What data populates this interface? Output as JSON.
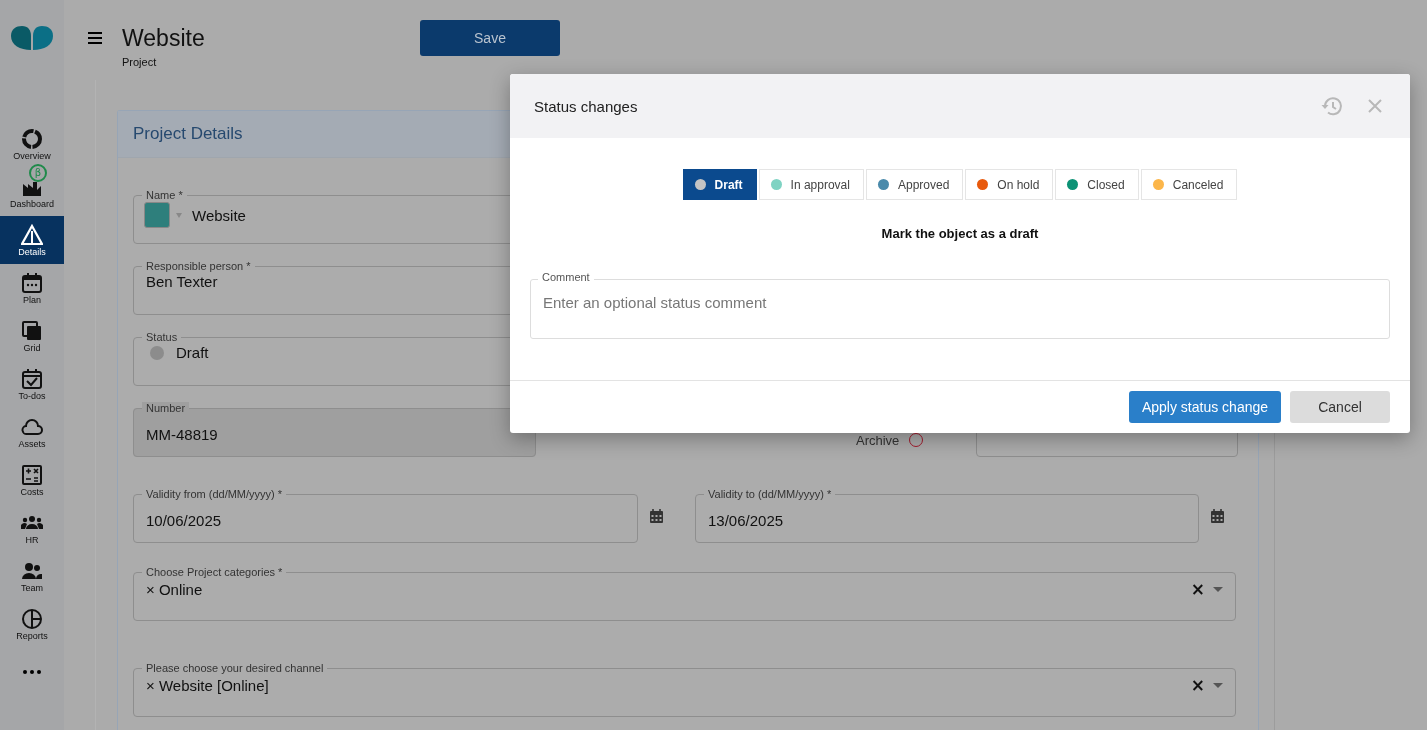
{
  "sidebar": {
    "items": [
      {
        "label": "Overview",
        "selected": false
      },
      {
        "label": "Dashboard",
        "selected": false,
        "badge": "β"
      },
      {
        "label": "Details",
        "selected": true
      },
      {
        "label": "Plan",
        "selected": false
      },
      {
        "label": "Grid",
        "selected": false
      },
      {
        "label": "To-dos",
        "selected": false
      },
      {
        "label": "Assets",
        "selected": false
      },
      {
        "label": "Costs",
        "selected": false
      },
      {
        "label": "HR",
        "selected": false
      },
      {
        "label": "Team",
        "selected": false
      },
      {
        "label": "Reports",
        "selected": false
      }
    ]
  },
  "header": {
    "title": "Website",
    "subtitle": "Project",
    "save_button": "Save"
  },
  "card": {
    "title": "Project Details",
    "fields": [
      {
        "kind": "swatch",
        "label": "Name *",
        "value": "Website",
        "color": "#2e7f7c"
      },
      {
        "kind": "text",
        "label": "Responsible person *",
        "value": "Ben Texter"
      },
      {
        "kind": "status",
        "label": "Status",
        "value": "Draft",
        "color": "#8c8c8c"
      },
      {
        "kind": "readonly",
        "label": "Number",
        "value": "MM-48819"
      }
    ],
    "archive_label": "Archive",
    "dates": [
      {
        "label": "Validity from (dd/MM/yyyy) *",
        "value": "10/06/2025"
      },
      {
        "label": "Validity to (dd/MM/yyyy) *",
        "value": "13/06/2025"
      }
    ],
    "tag_fields": [
      {
        "label": "Choose Project categories *",
        "tags": [
          "× Online"
        ],
        "clear": "×"
      },
      {
        "label": "Please choose your desired channel",
        "tags": [
          "× Website [Online]"
        ],
        "clear": "×"
      }
    ]
  },
  "dialog": {
    "title": "Status changes",
    "statuses": [
      {
        "label": "Draft",
        "color": "#c4c4c4",
        "selected": true
      },
      {
        "label": "In approval",
        "color": "#7fd3c3",
        "selected": false
      },
      {
        "label": "Approved",
        "color": "#4a8aab",
        "selected": false
      },
      {
        "label": "On hold",
        "color": "#e8590c",
        "selected": false
      },
      {
        "label": "Closed",
        "color": "#0c9275",
        "selected": false
      },
      {
        "label": "Canceled",
        "color": "#fcb64a",
        "selected": false
      }
    ],
    "description": "Mark the object as a draft",
    "comment": {
      "label": "Comment",
      "placeholder": "Enter an optional status comment"
    },
    "buttons": [
      "Apply status change",
      "Cancel"
    ]
  }
}
